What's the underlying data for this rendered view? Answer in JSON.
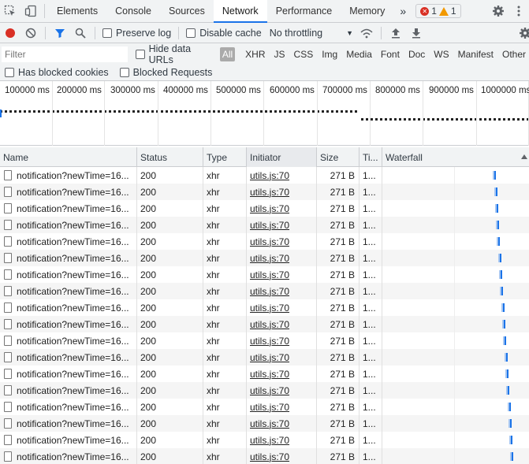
{
  "tabs": [
    "Elements",
    "Console",
    "Sources",
    "Network",
    "Performance",
    "Memory"
  ],
  "active_tab": "Network",
  "more_tabs_glyph": "»",
  "error_count": "1",
  "warning_count": "1",
  "toolbar": {
    "preserve_log": "Preserve log",
    "disable_cache": "Disable cache",
    "throttling": "No throttling"
  },
  "filter": {
    "placeholder": "Filter",
    "hide_data_urls": "Hide data URLs",
    "types": [
      "All",
      "XHR",
      "JS",
      "CSS",
      "Img",
      "Media",
      "Font",
      "Doc",
      "WS",
      "Manifest",
      "Other"
    ]
  },
  "row3": {
    "blocked_cookies": "Has blocked cookies",
    "blocked_requests": "Blocked Requests"
  },
  "overview_ticks": [
    "100000 ms",
    "200000 ms",
    "300000 ms",
    "400000 ms",
    "500000 ms",
    "600000 ms",
    "700000 ms",
    "800000 ms",
    "900000 ms",
    "1000000 ms"
  ],
  "columns": {
    "name": "Name",
    "status": "Status",
    "type": "Type",
    "initiator": "Initiator",
    "size": "Size",
    "time": "Ti...",
    "waterfall": "Waterfall"
  },
  "rows": [
    {
      "name": "notification?newTime=16...",
      "status": "200",
      "type": "xhr",
      "initiator": "utils.js:70",
      "size": "271 B",
      "time": "1...",
      "wf": 0.765
    },
    {
      "name": "notification?newTime=16...",
      "status": "200",
      "type": "xhr",
      "initiator": "utils.js:70",
      "size": "271 B",
      "time": "1...",
      "wf": 0.772
    },
    {
      "name": "notification?newTime=16...",
      "status": "200",
      "type": "xhr",
      "initiator": "utils.js:70",
      "size": "271 B",
      "time": "1...",
      "wf": 0.779
    },
    {
      "name": "notification?newTime=16...",
      "status": "200",
      "type": "xhr",
      "initiator": "utils.js:70",
      "size": "271 B",
      "time": "1...",
      "wf": 0.786
    },
    {
      "name": "notification?newTime=16...",
      "status": "200",
      "type": "xhr",
      "initiator": "utils.js:70",
      "size": "271 B",
      "time": "1...",
      "wf": 0.793
    },
    {
      "name": "notification?newTime=16...",
      "status": "200",
      "type": "xhr",
      "initiator": "utils.js:70",
      "size": "271 B",
      "time": "1...",
      "wf": 0.8
    },
    {
      "name": "notification?newTime=16...",
      "status": "200",
      "type": "xhr",
      "initiator": "utils.js:70",
      "size": "271 B",
      "time": "1...",
      "wf": 0.807
    },
    {
      "name": "notification?newTime=16...",
      "status": "200",
      "type": "xhr",
      "initiator": "utils.js:70",
      "size": "271 B",
      "time": "1...",
      "wf": 0.814
    },
    {
      "name": "notification?newTime=16...",
      "status": "200",
      "type": "xhr",
      "initiator": "utils.js:70",
      "size": "271 B",
      "time": "1...",
      "wf": 0.821
    },
    {
      "name": "notification?newTime=16...",
      "status": "200",
      "type": "xhr",
      "initiator": "utils.js:70",
      "size": "271 B",
      "time": "1...",
      "wf": 0.828
    },
    {
      "name": "notification?newTime=16...",
      "status": "200",
      "type": "xhr",
      "initiator": "utils.js:70",
      "size": "271 B",
      "time": "1...",
      "wf": 0.835
    },
    {
      "name": "notification?newTime=16...",
      "status": "200",
      "type": "xhr",
      "initiator": "utils.js:70",
      "size": "271 B",
      "time": "1...",
      "wf": 0.842
    },
    {
      "name": "notification?newTime=16...",
      "status": "200",
      "type": "xhr",
      "initiator": "utils.js:70",
      "size": "271 B",
      "time": "1...",
      "wf": 0.849
    },
    {
      "name": "notification?newTime=16...",
      "status": "200",
      "type": "xhr",
      "initiator": "utils.js:70",
      "size": "271 B",
      "time": "1...",
      "wf": 0.856
    },
    {
      "name": "notification?newTime=16...",
      "status": "200",
      "type": "xhr",
      "initiator": "utils.js:70",
      "size": "271 B",
      "time": "1...",
      "wf": 0.863
    },
    {
      "name": "notification?newTime=16...",
      "status": "200",
      "type": "xhr",
      "initiator": "utils.js:70",
      "size": "271 B",
      "time": "1...",
      "wf": 0.87
    },
    {
      "name": "notification?newTime=16...",
      "status": "200",
      "type": "xhr",
      "initiator": "utils.js:70",
      "size": "271 B",
      "time": "1...",
      "wf": 0.877
    },
    {
      "name": "notification?newTime=16...",
      "status": "200",
      "type": "xhr",
      "initiator": "utils.js:70",
      "size": "271 B",
      "time": "1...",
      "wf": 0.884
    }
  ]
}
